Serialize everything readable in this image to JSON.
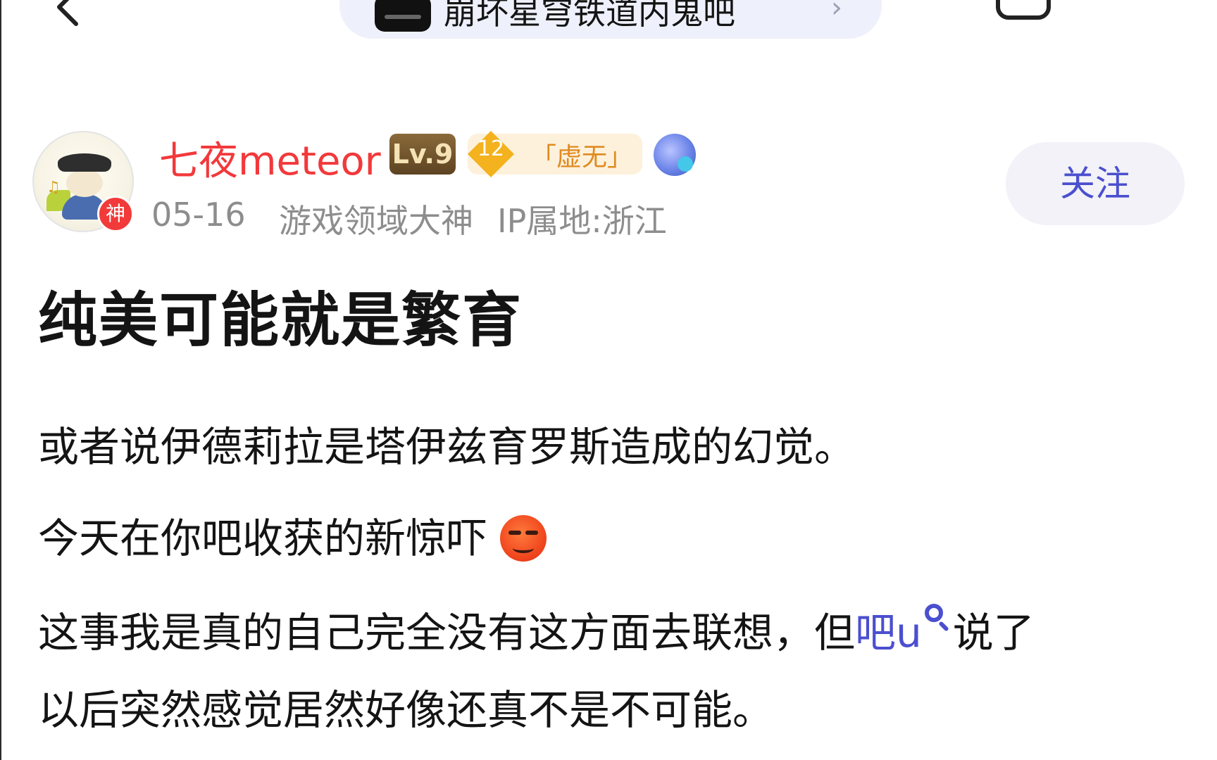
{
  "topbar": {
    "forum_name": "崩坏星穹铁道内鬼吧",
    "chevron": "›"
  },
  "author": {
    "name": "七夜meteor",
    "god_badge": "神",
    "level": "Lv.9",
    "rank_number": "12",
    "rank_title": "「虚无」",
    "date": "05-16",
    "title_tag": "游戏领域大神",
    "ip_location": "IP属地:浙江",
    "follow_label": "关注"
  },
  "post": {
    "title": "纯美可能就是繁育",
    "paragraph1": "或者说伊德莉拉是塔伊兹育罗斯造成的幻觉。",
    "paragraph2": "今天在你吧收获的新惊吓",
    "paragraph3_part1": "这事我是真的自己完全没有这方面去联想，但",
    "paragraph3_link": "吧u",
    "paragraph3_part2": "说了",
    "paragraph3_line2": "以后突然感觉居然好像还真不是不可能。"
  },
  "colors": {
    "username_red": "#f2393b",
    "accent_blue": "#4b4fcf",
    "meta_gray": "#8d8d8d"
  }
}
